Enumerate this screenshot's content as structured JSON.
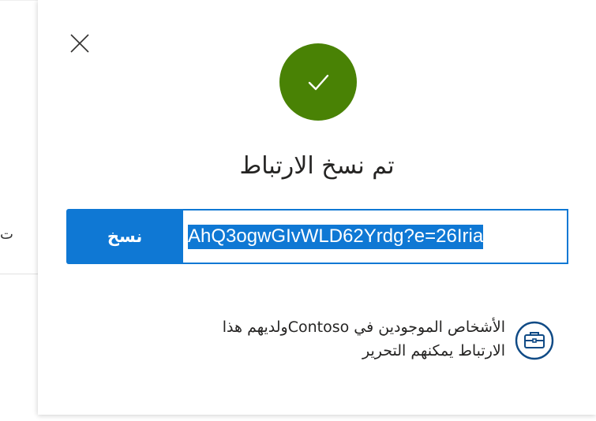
{
  "background": {
    "partial_char": "ت"
  },
  "dialog": {
    "title": "تم نسخ الارتباط",
    "copy_button_label": "نسخ",
    "link_value": "AhQ3ogwGIvWLD62Yrdg?e=26Iria",
    "permission": {
      "line1": "الأشخاص الموجودين في Contosoولديهم هذا",
      "line2": "الارتباط يمكنهم التحرير"
    },
    "icons": {
      "close": "close-icon",
      "success": "checkmark-icon",
      "permission": "briefcase-icon"
    }
  },
  "colors": {
    "success": "#498205",
    "accent": "#0f78d4"
  }
}
